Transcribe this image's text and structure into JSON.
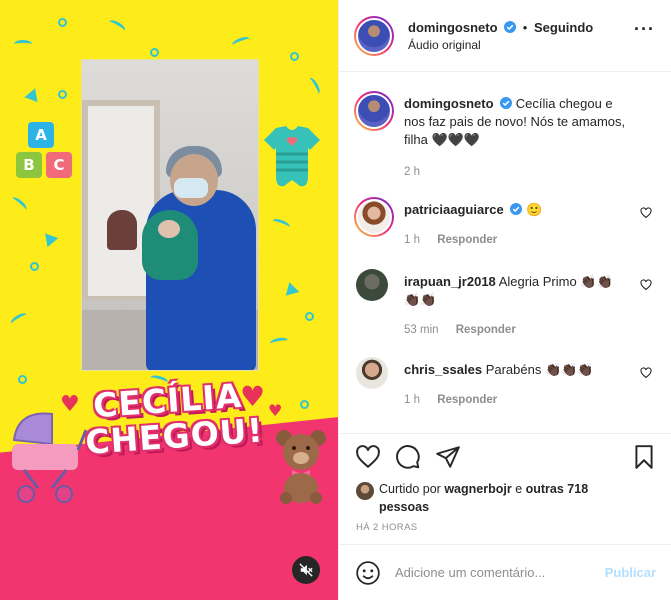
{
  "post": {
    "author": "domingosneto",
    "follow_state": "Seguindo",
    "audio": "Áudio original",
    "caption": "Cecília chegou e nos faz pais de novo! Nós te amamos, filha 🖤🖤🖤",
    "caption_time": "2 h"
  },
  "media": {
    "title_line1": "CECÍLIA",
    "title_line2": "CHEGOU!",
    "blocks": [
      "A",
      "B",
      "C"
    ],
    "mute_icon": "speaker-muted-icon"
  },
  "comments": [
    {
      "user": "patriciaaguiarce",
      "verified": true,
      "text": "🙂",
      "time": "1 h",
      "reply_label": "Responder"
    },
    {
      "user": "irapuan_jr2018",
      "verified": false,
      "text": "Alegria Primo 👏🏿👏🏿👏🏿👏🏿",
      "time": "53 min",
      "reply_label": "Responder"
    },
    {
      "user": "chris_ssales",
      "verified": false,
      "text": "Parabéns 👏🏿👏🏿👏🏿",
      "time": "1 h",
      "reply_label": "Responder"
    }
  ],
  "likes": {
    "prefix": "Curtido por",
    "user": "wagnerbojr",
    "connector": "e",
    "others": "outras 718 pessoas"
  },
  "timestamp": "HÁ 2 HORAS",
  "add_comment": {
    "placeholder": "Adicione um comentário...",
    "publish_label": "Publicar"
  },
  "colors": {
    "media_yellow": "#fdeb1a",
    "media_pink": "#f2356f",
    "verified_blue": "#3897f0",
    "publish_disabled": "#b2dffc",
    "muted_text": "#8e8e8e"
  }
}
